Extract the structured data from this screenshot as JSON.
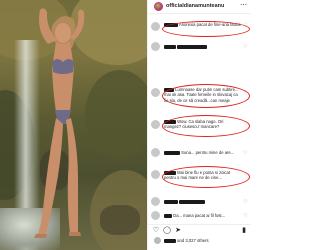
{
  "post": {
    "username": "officialdianamunteanu",
    "more_icon": "more-horizontal-icon"
  },
  "comments": [
    {
      "snippet": "Anorexia pacat de fine-aria fauna",
      "meta": "",
      "circled": true
    },
    {
      "snippet": "",
      "meta": "",
      "circled": false
    },
    {
      "snippet": "Lumnoase dar putin cam subtire... mai ok asa. Toate femeile in slovacaj ca fie sla, de ce să creadă...can meaje",
      "meta": "",
      "circled": true
    },
    {
      "snippet": "Wow. Ca slaba nago. Ori mangez? ciusescu' mancare?",
      "meta": "",
      "circled": true
    },
    {
      "snippet": "Suna... pentru mine de are...",
      "meta": "",
      "circled": false
    },
    {
      "snippet": "Mai bine flu e ponta si zoicat pentru o mai mare ne de cine...",
      "meta": "",
      "circled": true
    },
    {
      "snippet": "",
      "meta": "",
      "circled": false
    },
    {
      "snippet": "Da... mana pacat ai fil fost...",
      "meta": "",
      "circled": false
    }
  ],
  "likes": {
    "text": "and 3,027 others"
  },
  "icons": {
    "like": "heart-icon",
    "comment": "comment-icon",
    "share": "share-icon",
    "save": "bookmark-icon"
  },
  "colors": {
    "annotation_ring": "#e0201c",
    "story_ring": "#d6249f",
    "text": "#262626",
    "muted": "#8e8e8e"
  }
}
